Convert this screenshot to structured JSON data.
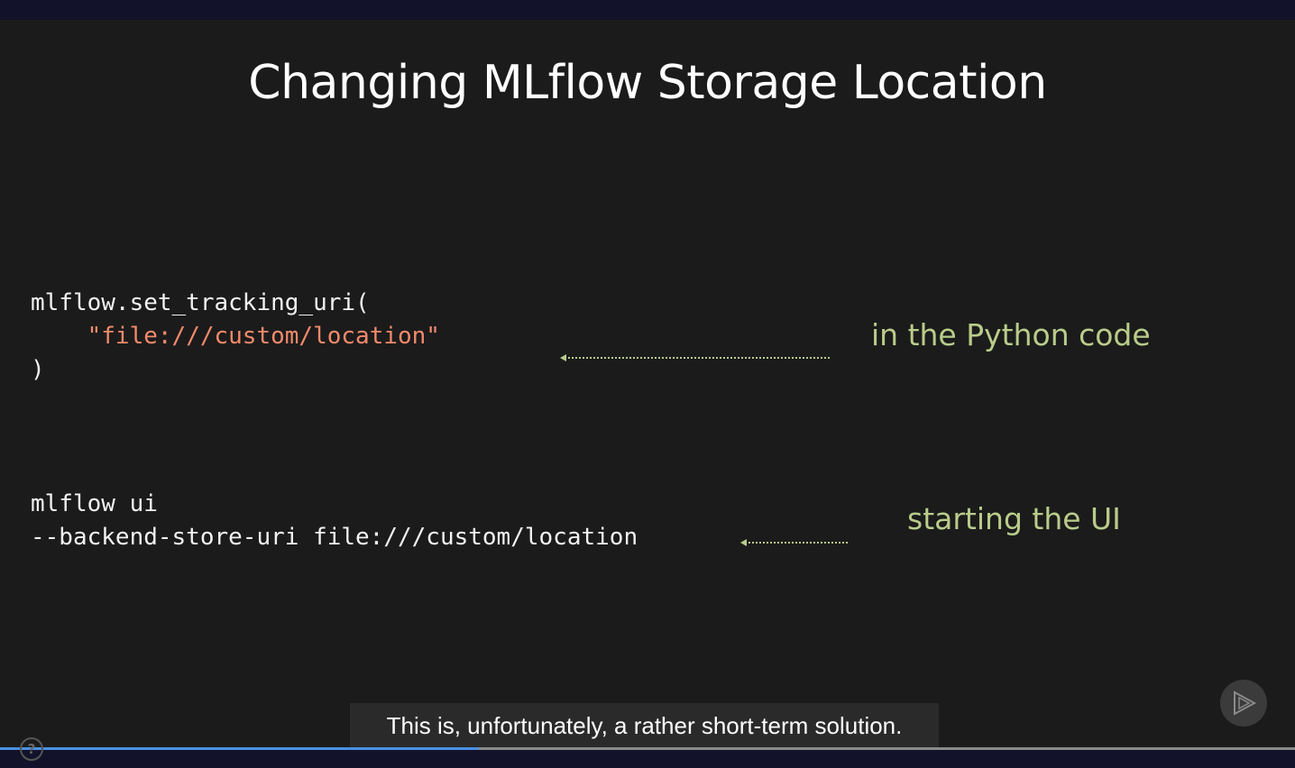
{
  "slide": {
    "title": "Changing MLflow Storage Location",
    "code_block_1": {
      "line1": "mlflow.set_tracking_uri(",
      "line2_indent": "    ",
      "line2_string": "\"file:///custom/location\"",
      "line3": ")"
    },
    "code_block_2": {
      "line1": "mlflow ui",
      "line2": "--backend-store-uri file:///custom/location"
    },
    "note_1": "in the Python code",
    "note_2": "starting the UI"
  },
  "player": {
    "caption": "This is, unfortunately, a rather short-term solution.",
    "progress": 0.37,
    "help_label": "?"
  },
  "icons": {
    "play": "play-outline-icon",
    "help": "help-icon",
    "arrow": "dotted-arrow-left-icon"
  },
  "colors": {
    "slide_bg": "#1b1b1b",
    "code_text": "#f2f2f2",
    "code_string": "#f28a6b",
    "note_text": "#b9cc8a",
    "progress_fill": "#4a90e2"
  }
}
